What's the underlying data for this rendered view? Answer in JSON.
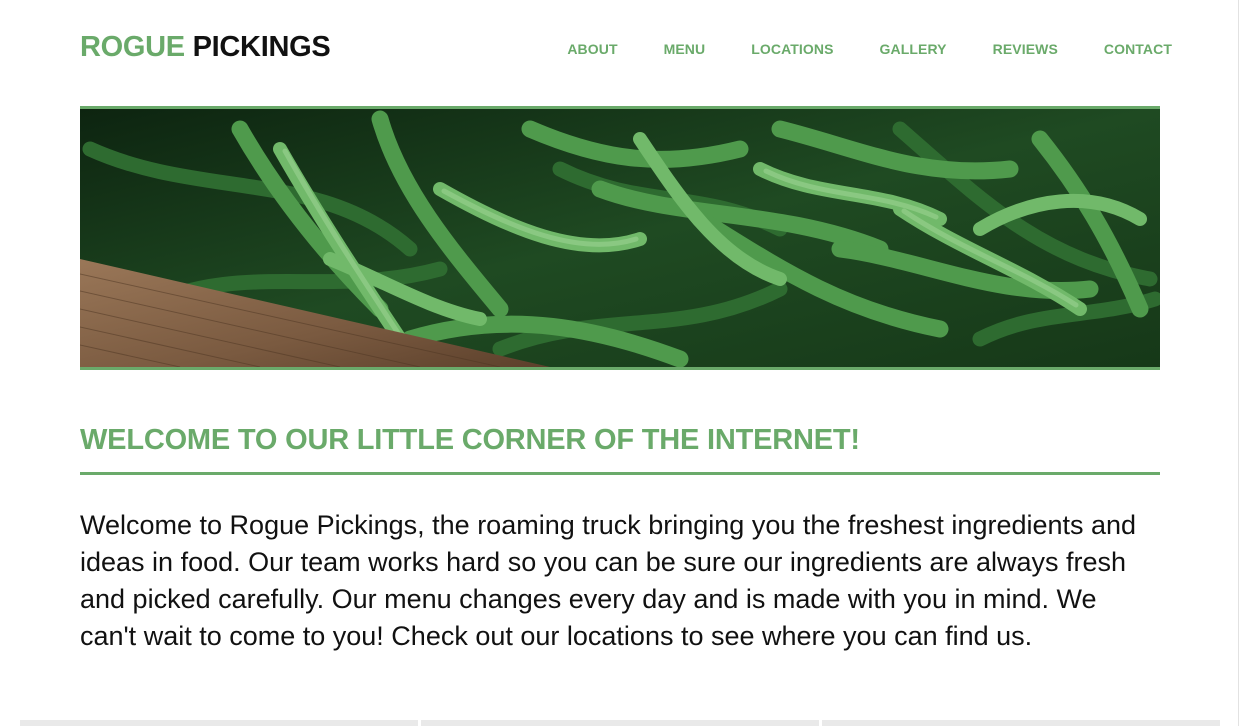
{
  "brand": {
    "part1": "ROGUE",
    "part2": "PICKINGS",
    "accent_color": "#6aaa6a"
  },
  "nav": {
    "items": [
      {
        "label": "ABOUT"
      },
      {
        "label": "MENU"
      },
      {
        "label": "LOCATIONS"
      },
      {
        "label": "GALLERY"
      },
      {
        "label": "REVIEWS"
      },
      {
        "label": "CONTACT"
      }
    ]
  },
  "hero": {
    "image": "green-beans-in-wooden-crate"
  },
  "main": {
    "heading": "WELCOME TO OUR LITTLE CORNER OF THE INTERNET!",
    "intro": "Welcome to Rogue Pickings, the roaming truck bringing you the freshest ingredients and ideas in food. Our team works hard so you can be sure our ingredients are always fresh and picked carefully. Our menu changes every day and is made with you in mind. We can't wait to come to you! Check out our locations to see where you can find us."
  }
}
